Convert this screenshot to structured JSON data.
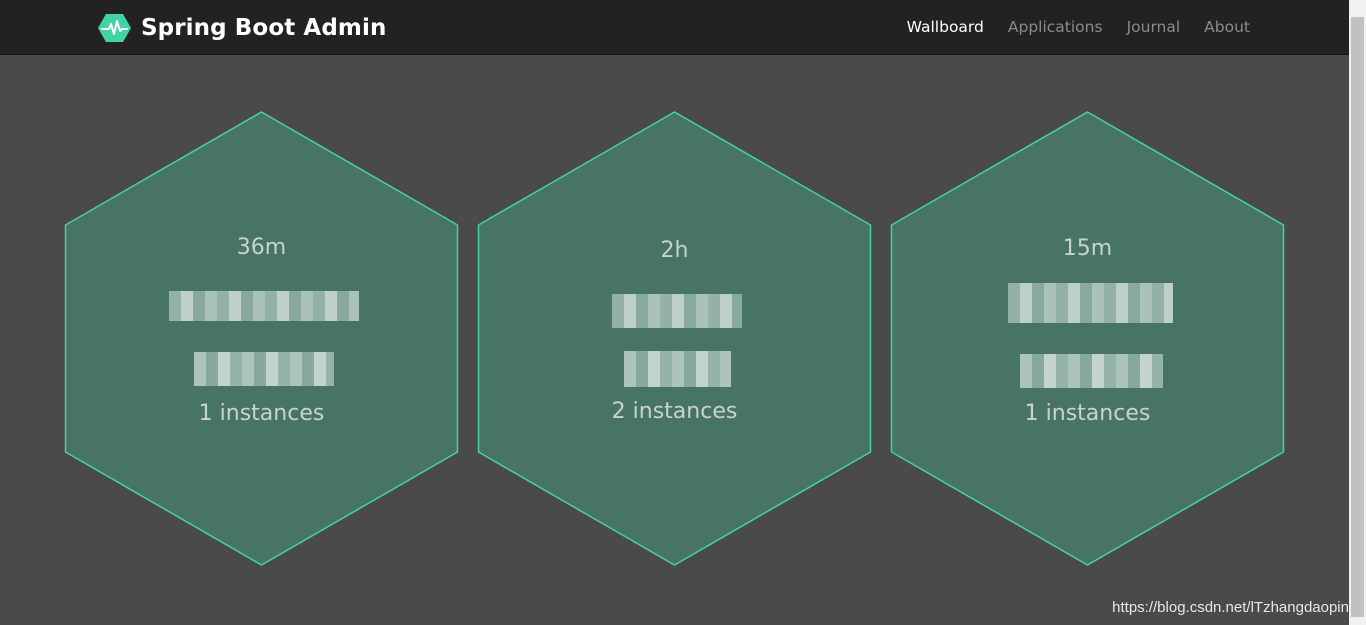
{
  "app": {
    "title": "Spring Boot Admin",
    "logo_icon": "heartbeat-hexagon-icon",
    "accent_color": "#42d3a5"
  },
  "nav": {
    "items": [
      {
        "label": "Wallboard",
        "active": true
      },
      {
        "label": "Applications",
        "active": false
      },
      {
        "label": "Journal",
        "active": false
      },
      {
        "label": "About",
        "active": false
      }
    ]
  },
  "wallboard": {
    "hex_fill": "#487467",
    "hex_stroke": "#42d3a5",
    "apps": [
      {
        "uptime": "36m",
        "name": "",
        "instances": "1 instances"
      },
      {
        "uptime": "2h",
        "name": "",
        "instances": "2 instances"
      },
      {
        "uptime": "15m",
        "name": "",
        "instances": "1 instances"
      }
    ]
  },
  "watermark": "https://blog.csdn.net/lTzhangdaopin"
}
